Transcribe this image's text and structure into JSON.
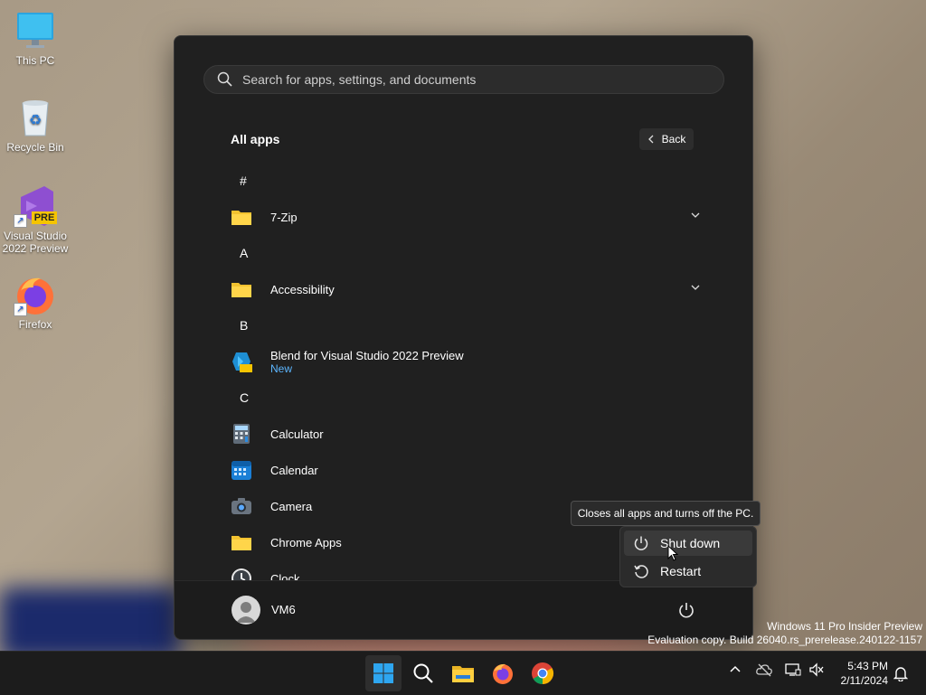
{
  "desktop": {
    "icons": [
      {
        "label": "This PC"
      },
      {
        "label": "Recycle Bin"
      },
      {
        "label": "Visual Studio 2022 Preview",
        "badge": "PRE"
      },
      {
        "label": "Firefox"
      }
    ],
    "watermark": {
      "line1": "Windows 11 Pro Insider Preview",
      "line2": "Evaluation copy. Build 26040.rs_prerelease.240122-1157"
    }
  },
  "start_menu": {
    "search_placeholder": "Search for apps, settings, and documents",
    "title": "All apps",
    "back_label": "Back",
    "letters": [
      "#",
      "A",
      "B",
      "C"
    ],
    "apps": [
      {
        "name": "7-Zip"
      },
      {
        "name": "Accessibility"
      },
      {
        "name": "Blend for Visual Studio 2022 Preview",
        "sub": "New"
      },
      {
        "name": "Calculator"
      },
      {
        "name": "Calendar"
      },
      {
        "name": "Camera"
      },
      {
        "name": "Chrome Apps"
      },
      {
        "name": "Clock"
      }
    ],
    "user": {
      "name": "VM6"
    }
  },
  "power_menu": {
    "tooltip": "Closes all apps and turns off the PC.",
    "shutdown_label": "Shut down",
    "restart_label": "Restart"
  },
  "taskbar": {
    "time": "5:43 PM",
    "date": "2/11/2024"
  },
  "colors": {
    "accent": "#0078d4",
    "new_badge": "#5cb6ff",
    "menu_bg": "#202020",
    "taskbar_bg": "#1c1c1c"
  }
}
